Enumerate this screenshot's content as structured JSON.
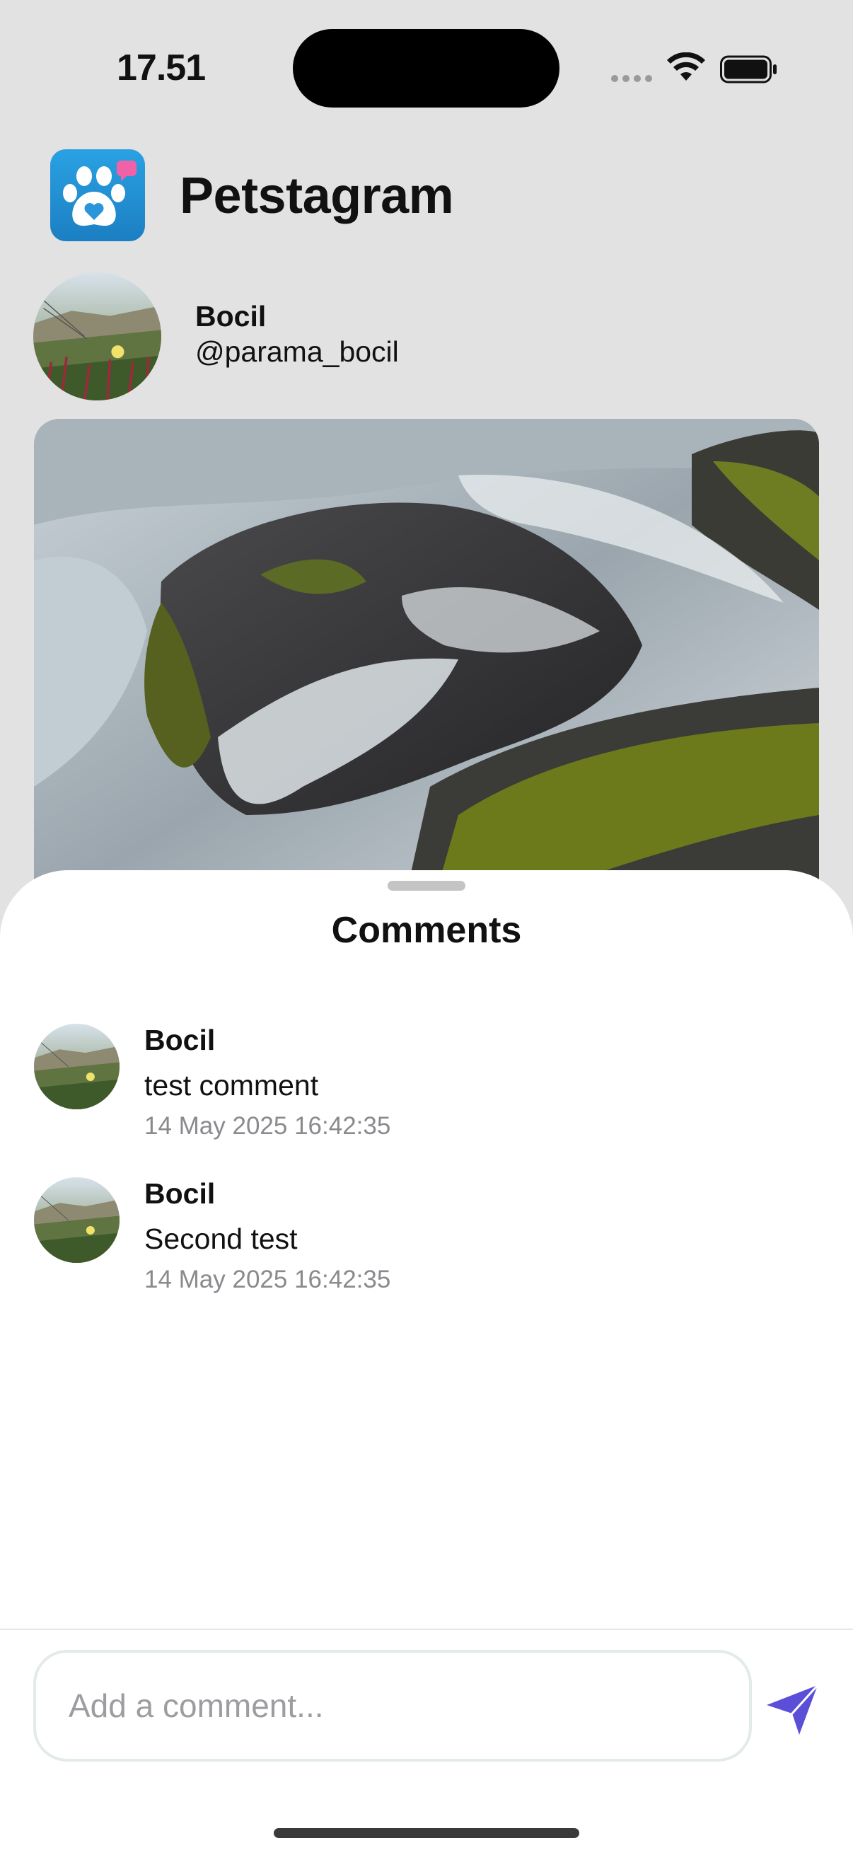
{
  "status_bar": {
    "time": "17.51",
    "icons": [
      "signal-icon",
      "wifi-icon",
      "battery-icon"
    ]
  },
  "header": {
    "app_title": "Petstagram",
    "app_icon": "paw-heart-icon"
  },
  "profile": {
    "name": "Bocil",
    "handle": "@parama_bocil"
  },
  "comments_sheet": {
    "title": "Comments",
    "items": [
      {
        "author": "Bocil",
        "text": "test comment",
        "timestamp": "14 May 2025 16:42:35"
      },
      {
        "author": "Bocil",
        "text": "Second test",
        "timestamp": "14 May 2025 16:42:35"
      }
    ],
    "input": {
      "placeholder": "Add a comment...",
      "value": ""
    },
    "send_icon": "paper-plane-icon"
  },
  "colors": {
    "background": "#e2e2e2",
    "accent": "#5b4fd8",
    "app_icon_blue": "#1f8fd6",
    "notification_pink": "#f062a8",
    "muted_text": "#8a8a8e"
  }
}
